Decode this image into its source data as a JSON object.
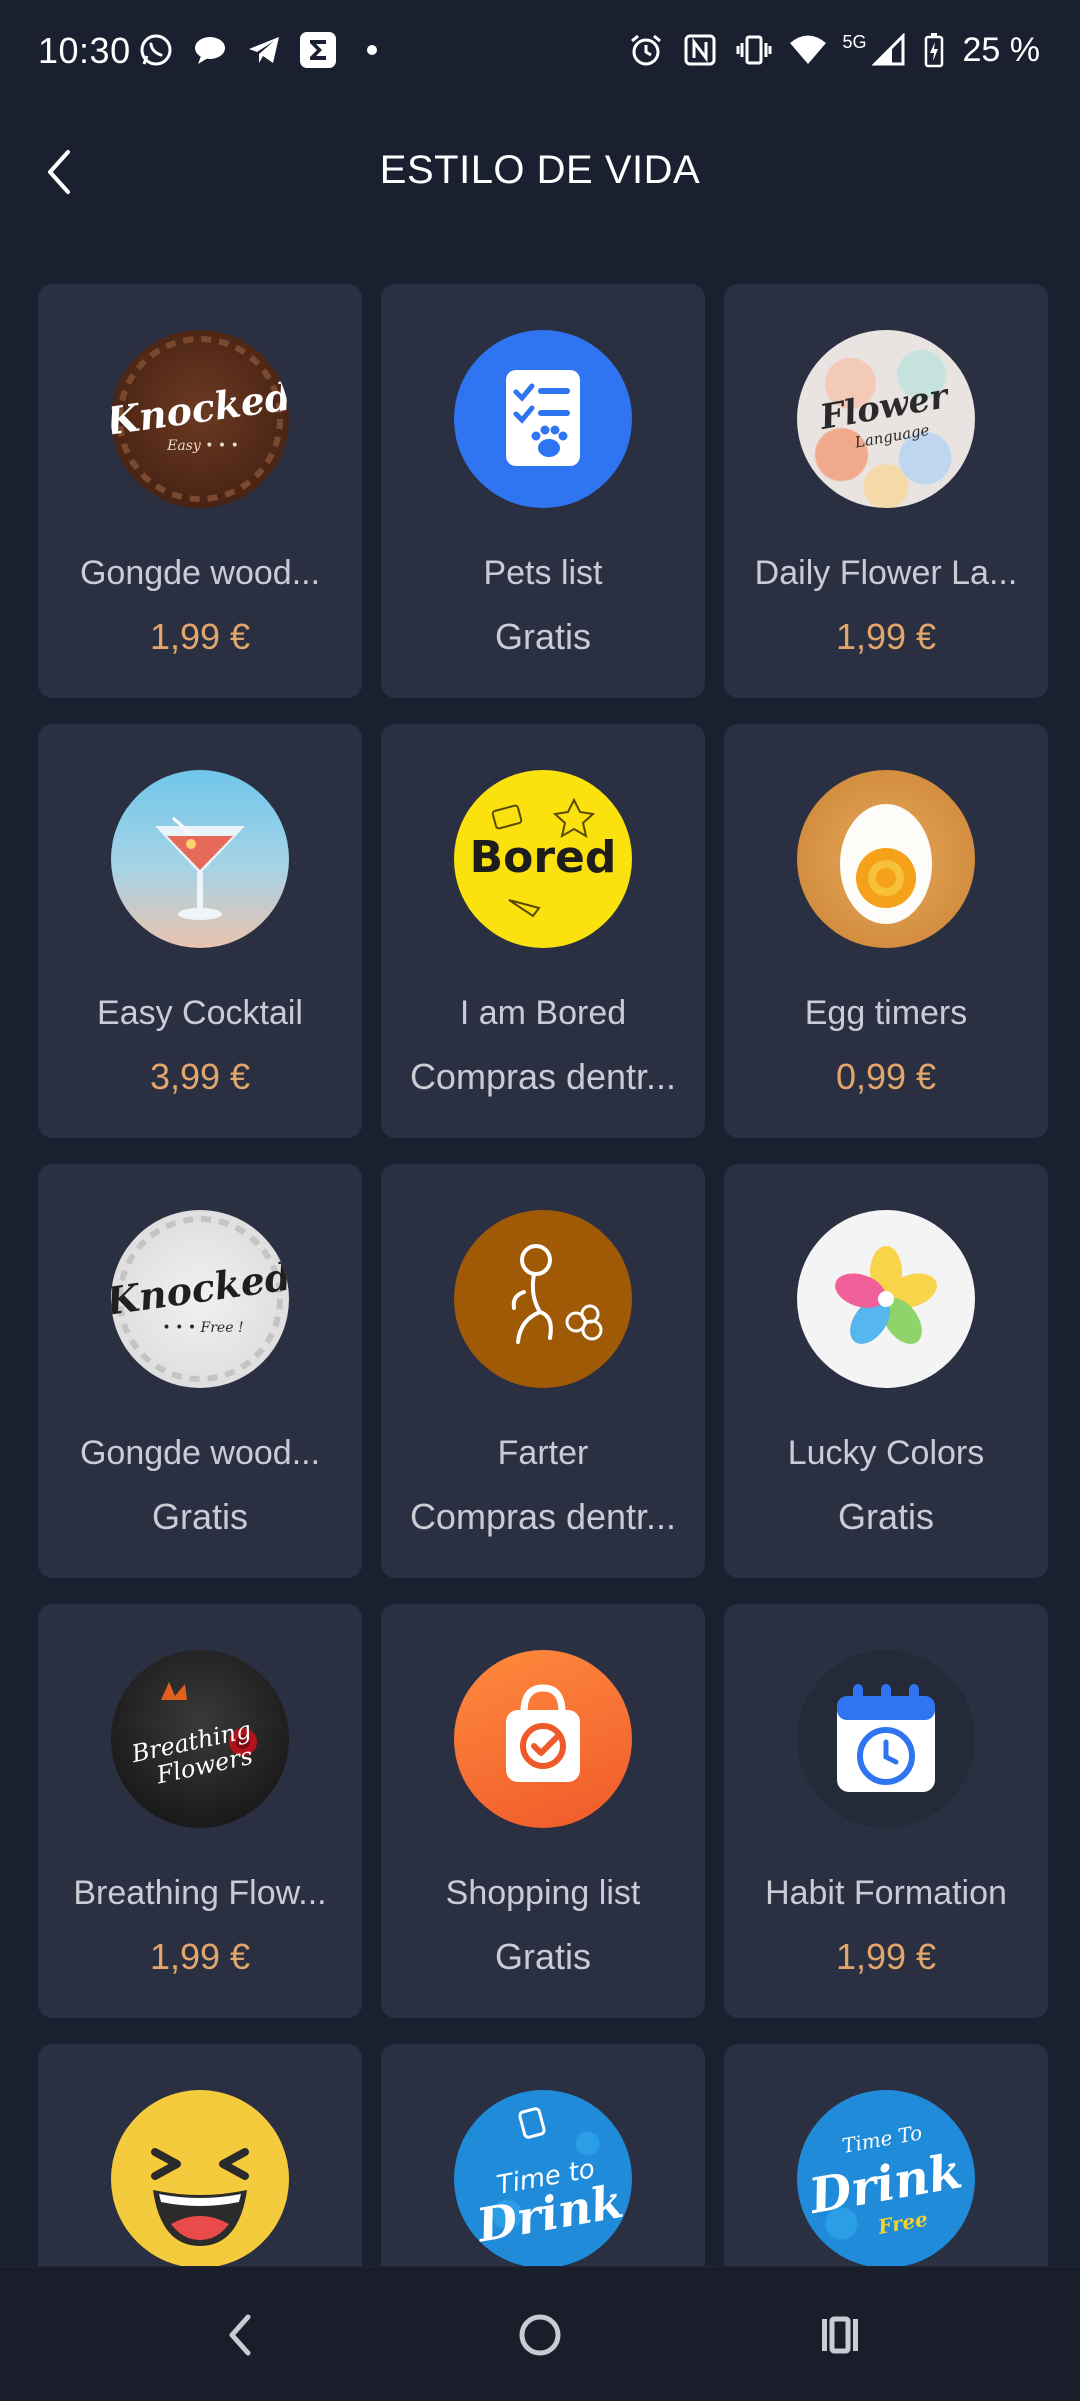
{
  "status_bar": {
    "time": "10:30",
    "network": "5G",
    "battery": "25 %",
    "left_icons": [
      "whatsapp-icon",
      "chat-bubble-icon",
      "telegram-icon",
      "sigma-app-icon",
      "dot-icon"
    ],
    "right_icons": [
      "alarm-icon",
      "nfc-icon",
      "vibrate-icon",
      "wifi-icon",
      "signal-icon",
      "battery-icon"
    ]
  },
  "header": {
    "title": "ESTILO DE VIDA",
    "back_icon": "chevron-left-icon"
  },
  "apps": [
    {
      "name": "Gongde wood...",
      "price": "1,99 €",
      "paid": true,
      "icon": "knocked-wood-icon"
    },
    {
      "name": "Pets list",
      "price": "Gratis",
      "paid": false,
      "icon": "pets-list-icon"
    },
    {
      "name": "Daily Flower La...",
      "price": "1,99 €",
      "paid": true,
      "icon": "flower-language-icon"
    },
    {
      "name": "Easy Cocktail",
      "price": "3,99 €",
      "paid": true,
      "icon": "cocktail-icon"
    },
    {
      "name": "I am Bored",
      "price": "Compras dentr...",
      "paid": false,
      "icon": "bored-icon"
    },
    {
      "name": "Egg timers",
      "price": "0,99 €",
      "paid": true,
      "icon": "egg-icon"
    },
    {
      "name": "Gongde wood...",
      "price": "Gratis",
      "paid": false,
      "icon": "knocked-free-icon"
    },
    {
      "name": "Farter",
      "price": "Compras dentr...",
      "paid": false,
      "icon": "farter-icon"
    },
    {
      "name": "Lucky Colors",
      "price": "Gratis",
      "paid": false,
      "icon": "lucky-colors-icon"
    },
    {
      "name": "Breathing Flow...",
      "price": "1,99 €",
      "paid": true,
      "icon": "breathing-flowers-icon"
    },
    {
      "name": "Shopping list",
      "price": "Gratis",
      "paid": false,
      "icon": "shopping-bag-icon"
    },
    {
      "name": "Habit Formation",
      "price": "1,99 €",
      "paid": true,
      "icon": "alarm-calendar-icon"
    },
    {
      "name": "",
      "price": "",
      "paid": false,
      "icon": "laughing-emoji-icon"
    },
    {
      "name": "",
      "price": "",
      "paid": false,
      "icon": "time-to-drink-icon"
    },
    {
      "name": "",
      "price": "",
      "paid": false,
      "icon": "time-to-drink-free-icon"
    }
  ],
  "icon_text": {
    "knocked": "Knocked",
    "knocked_sub": "Easy • • •",
    "knocked_free_sub": "• • • Free !",
    "flower": "Flower",
    "flower_sub": "Language",
    "bored": "Bored",
    "breathing": "Breathing",
    "flowers": "Flowers",
    "time_to": "Time to",
    "drink": "Drink",
    "time_to_2": "Time To",
    "free": "Free"
  },
  "colors": {
    "background": "#1b2031",
    "card": "#2a3042",
    "price_paid": "#e3a66a",
    "text": "#c8ccd5"
  },
  "nav_bar": {
    "back": "back-triangle-icon",
    "home": "home-circle-icon",
    "recents": "recents-icon"
  }
}
